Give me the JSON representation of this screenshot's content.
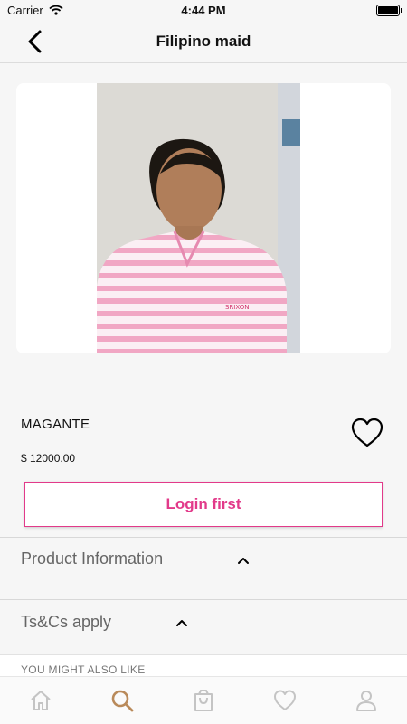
{
  "status_bar": {
    "carrier": "Carrier",
    "time": "4:44 PM"
  },
  "nav": {
    "title": "Filipino maid"
  },
  "product": {
    "name": "MAGANTE",
    "price": "$ 12000.00",
    "action_label": "Login first"
  },
  "sections": [
    {
      "label": "Product Information",
      "expanded": true
    },
    {
      "label": "Ts&Cs apply",
      "expanded": true
    }
  ],
  "recommendations": {
    "label": "YOU MIGHT ALSO LIKE"
  },
  "tabs": [
    {
      "icon": "home-icon",
      "active": false
    },
    {
      "icon": "search-icon",
      "active": true
    },
    {
      "icon": "shopping-bag-icon",
      "active": false
    },
    {
      "icon": "heart-icon",
      "active": false
    },
    {
      "icon": "profile-icon",
      "active": false
    }
  ],
  "colors": {
    "accent": "#e23a8a",
    "active_tab": "#b98a5a",
    "inactive_tab": "#c4c4c4",
    "photo_stripe": "#f1a7c4"
  }
}
